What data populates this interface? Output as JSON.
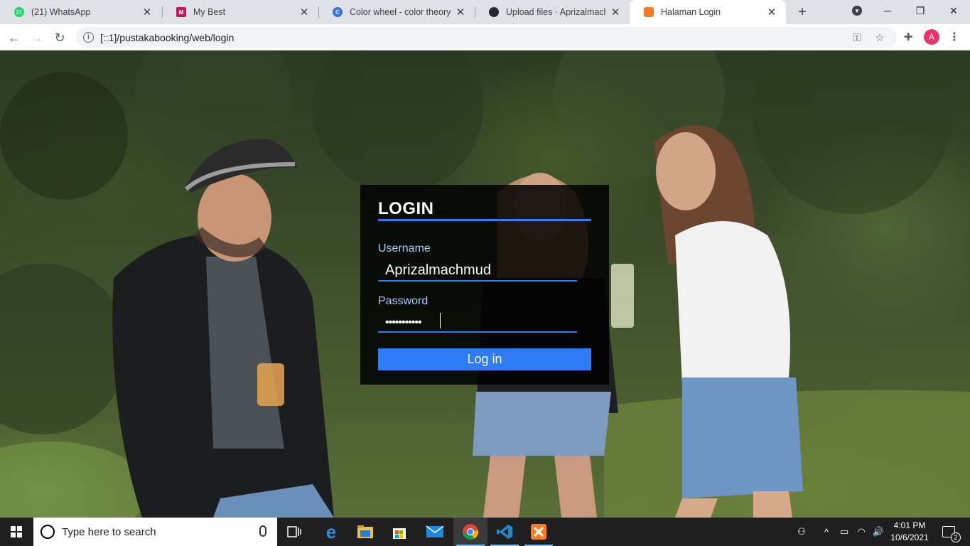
{
  "browser": {
    "tabs": [
      {
        "title": "(21) WhatsApp",
        "favicon": "whatsapp-icon",
        "favicon_color": "#25d366",
        "badge": "21",
        "active": false
      },
      {
        "title": "My Best",
        "favicon": "mybest-icon",
        "favicon_color": "#c2185b",
        "badge": "M",
        "active": false
      },
      {
        "title": "Color wheel - color theory an",
        "favicon": "color-wheel-icon",
        "favicon_color": "#3b73e0",
        "badge": "C",
        "active": false
      },
      {
        "title": "Upload files · Aprizalmachmu",
        "favicon": "github-icon",
        "favicon_color": "#24292e",
        "badge": "",
        "active": false
      },
      {
        "title": "Halaman Login",
        "favicon": "xampp-icon",
        "favicon_color": "#fb7a24",
        "badge": "",
        "active": true
      }
    ],
    "url": "[::1]/pustakabooking/web/login",
    "profile_initial": "A"
  },
  "login": {
    "title": "LOGIN",
    "username_label": "Username",
    "username_value": "Aprizalmachmud",
    "password_label": "Password",
    "password_mask": "•••••••••••",
    "submit_label": "Log in",
    "accent_color": "#2f7bf5"
  },
  "taskbar": {
    "search_placeholder": "Type here to search",
    "time": "4:01 PM",
    "date": "10/6/2021",
    "notification_count": "2",
    "pinned_apps": [
      "task-view-icon",
      "edge-icon",
      "file-explorer-icon",
      "store-icon",
      "mail-icon",
      "chrome-icon",
      "vscode-icon",
      "xampp-icon"
    ]
  }
}
